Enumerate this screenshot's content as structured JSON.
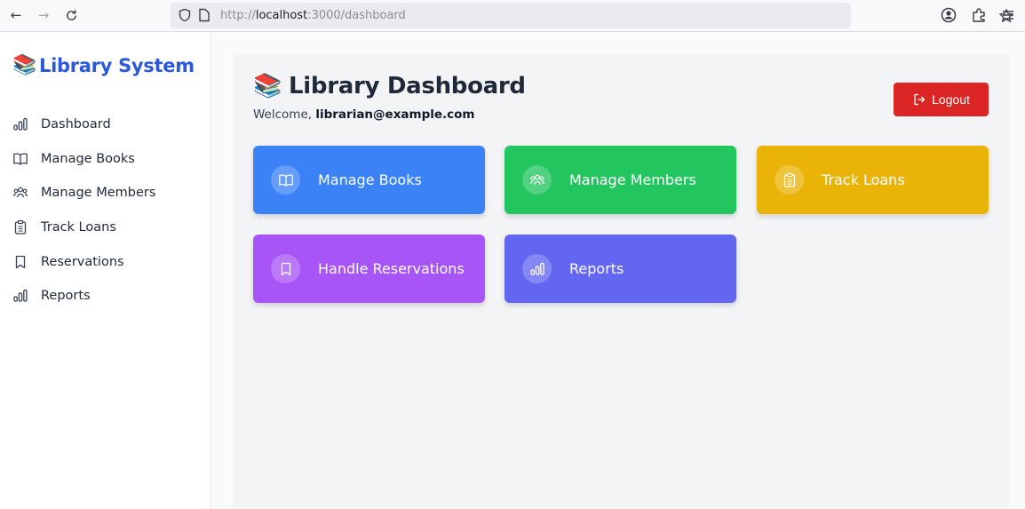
{
  "browser": {
    "url_scheme": "http://",
    "url_host": "localhost",
    "url_path": ":3000/dashboard"
  },
  "sidebar": {
    "brand_emoji": "📚",
    "brand_title": "Library System",
    "items": [
      {
        "label": "Dashboard",
        "icon": "bar-chart-icon"
      },
      {
        "label": "Manage Books",
        "icon": "book-open-icon"
      },
      {
        "label": "Manage Members",
        "icon": "users-icon"
      },
      {
        "label": "Track Loans",
        "icon": "clipboard-icon"
      },
      {
        "label": "Reservations",
        "icon": "bookmark-icon"
      },
      {
        "label": "Reports",
        "icon": "bar-chart-icon"
      }
    ]
  },
  "main": {
    "title_emoji": "📚",
    "title": "Library Dashboard",
    "welcome_prefix": "Welcome, ",
    "user_email": "librarian@example.com",
    "logout_label": "Logout",
    "cards": [
      {
        "label": "Manage Books",
        "icon": "book-open-icon",
        "color": "#3b82f6"
      },
      {
        "label": "Manage Members",
        "icon": "users-icon",
        "color": "#22c55e"
      },
      {
        "label": "Track Loans",
        "icon": "clipboard-icon",
        "color": "#eab308"
      },
      {
        "label": "Handle Reservations",
        "icon": "bookmark-icon",
        "color": "#a855f7"
      },
      {
        "label": "Reports",
        "icon": "bar-chart-icon",
        "color": "#6366f1"
      }
    ]
  },
  "colors": {
    "brand": "#2b59d9",
    "logout": "#dc2626"
  }
}
